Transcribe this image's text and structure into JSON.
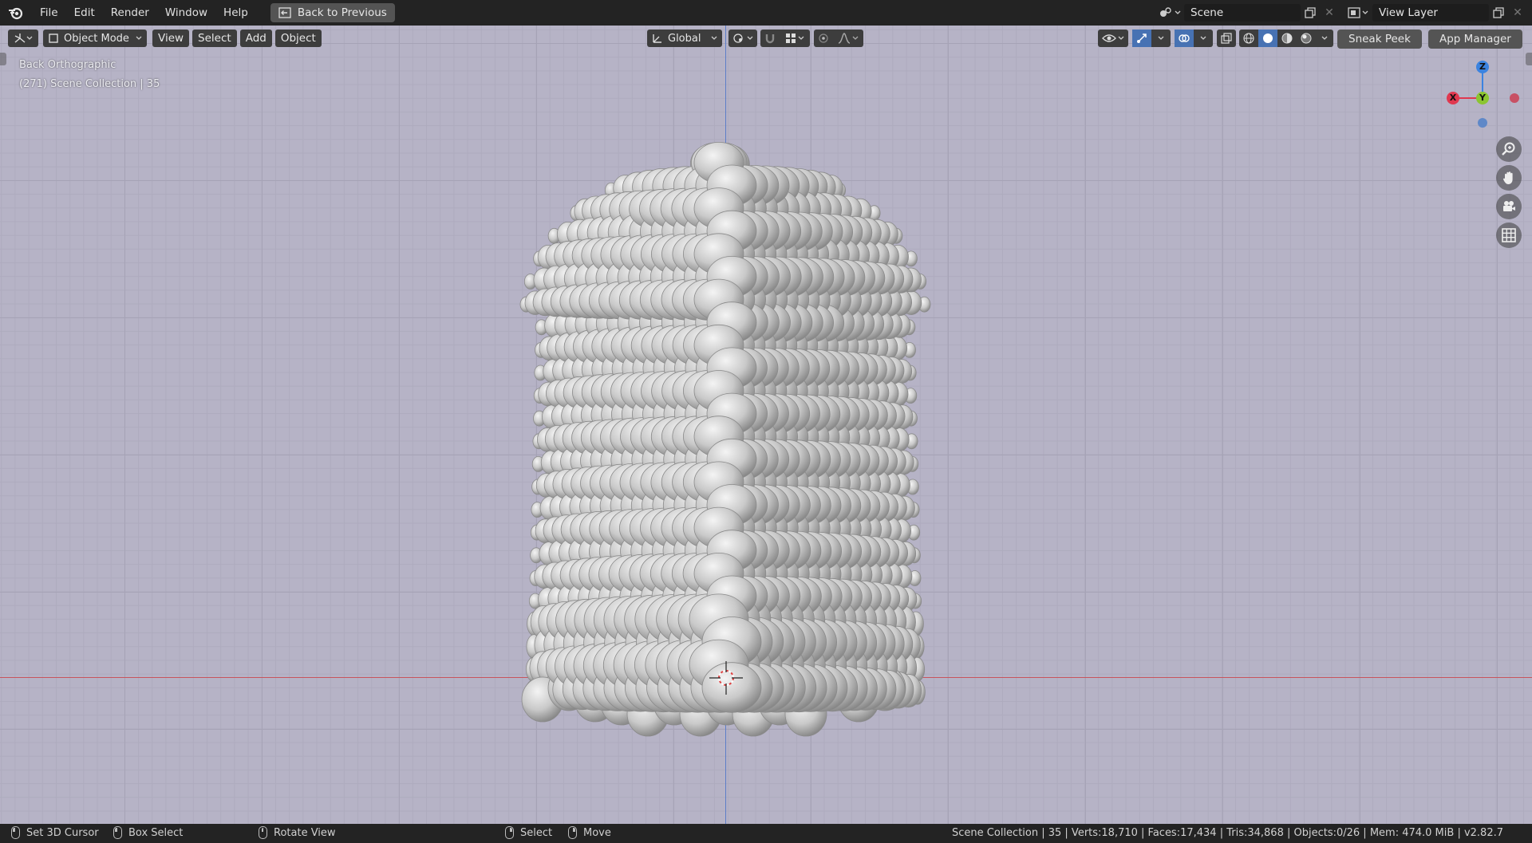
{
  "topbar": {
    "menus": [
      "File",
      "Edit",
      "Render",
      "Window",
      "Help"
    ],
    "back_button": "Back to Previous",
    "scene_value": "Scene",
    "view_layer_value": "View Layer"
  },
  "viewport_header": {
    "mode": "Object Mode",
    "menus": [
      "View",
      "Select",
      "Add",
      "Object"
    ],
    "orientation": "Global",
    "sneak_peek": "Sneak Peek",
    "app_manager": "App Manager"
  },
  "overlay": {
    "view_name": "Back Orthographic",
    "collection_info": "(271) Scene Collection | 35"
  },
  "gizmo": {
    "z_label": "Z",
    "x_label": "X",
    "y_label": "Y",
    "colors": {
      "x": "#e0384f",
      "y": "#8bc531",
      "z": "#3b83e0"
    }
  },
  "nav_icons": [
    "zoom-icon",
    "hand-pan-icon",
    "camera-icon",
    "grid-icon"
  ],
  "statusbar": {
    "set_cursor": "Set 3D Cursor",
    "box_select": "Box Select",
    "rotate_view": "Rotate View",
    "select": "Select",
    "move": "Move",
    "stats": "Scene Collection | 35 | Verts:18,710 | Faces:17,434 | Tris:34,868 | Objects:0/26 | Mem: 474.0 MiB | v2.82.7"
  }
}
